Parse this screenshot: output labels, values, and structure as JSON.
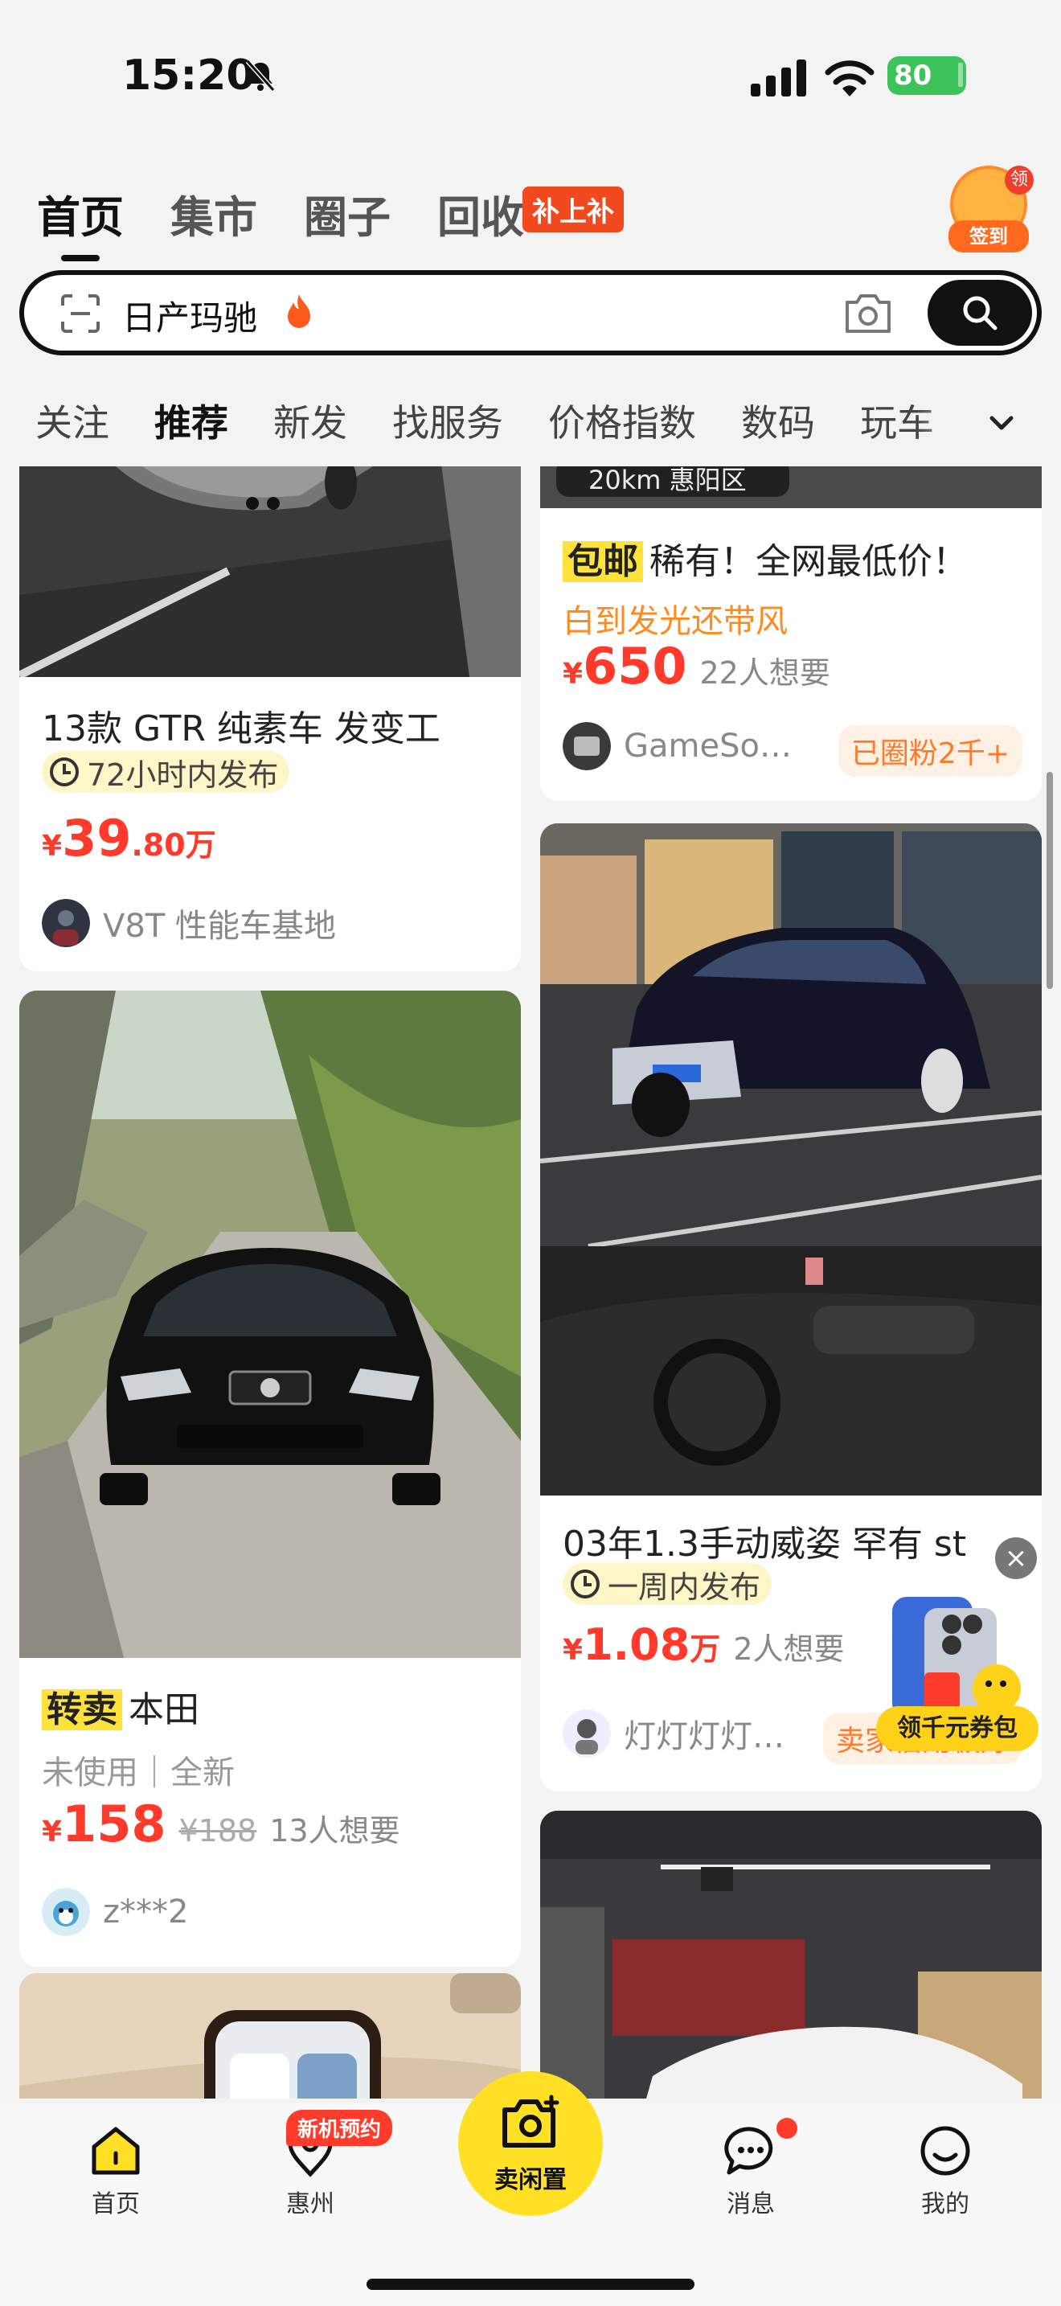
{
  "status_bar": {
    "time": "15:20",
    "battery": "80"
  },
  "top_tabs": [
    {
      "label": "首页",
      "active": true
    },
    {
      "label": "集市",
      "active": false
    },
    {
      "label": "圈子",
      "active": false
    },
    {
      "label": "回收",
      "active": false
    }
  ],
  "recycle_badge": "补上补",
  "checkin": {
    "corner": "领",
    "label": "签到"
  },
  "search": {
    "query": "日产玛驰"
  },
  "categories": [
    "关注",
    "推荐",
    "新发",
    "找服务",
    "价格指数",
    "数码",
    "玩车"
  ],
  "active_category": "推荐",
  "feed": {
    "left": [
      {
        "title": "13款 GTR 纯素车 发变工",
        "time_tag": "72小时内发布",
        "price_yen": "¥",
        "price_big": "39",
        "price_small": ".80万",
        "seller": "V8T 性能车基地"
      },
      {
        "tag": "转卖",
        "title": "本田",
        "condition": "未使用｜全新",
        "price_yen": "¥",
        "price_big": "158",
        "orig_price": "¥188",
        "wants": "13人想要",
        "seller": "z***2"
      }
    ],
    "right": [
      {
        "location": "20km 惠阳区",
        "tag": "包邮",
        "title": "稀有！全网最低价！",
        "subtitle": "白到发光还带风",
        "price_yen": "¥",
        "price_big": "650",
        "wants": "22人想要",
        "seller": "GameSo…",
        "fans": "已圈粉2千+"
      },
      {
        "title": "03年1.3手动威姿 罕有 st",
        "time_tag": "一周内发布",
        "price_yen": "¥",
        "price_big": "1.08",
        "price_unit": "万",
        "wants": "2人想要",
        "seller": "灯灯灯灯…",
        "seller_badge": "卖家信用极好"
      }
    ]
  },
  "promo": {
    "close": "×",
    "label": "领千元券包"
  },
  "bottom_nav": {
    "home": "首页",
    "city": "惠州",
    "city_badge": "新机预约",
    "sell": "卖闲置",
    "messages": "消息",
    "me": "我的"
  },
  "colors": {
    "accent_yellow": "#ffe024",
    "price_red": "#ff3a2a",
    "orange": "#ff8a1e"
  }
}
